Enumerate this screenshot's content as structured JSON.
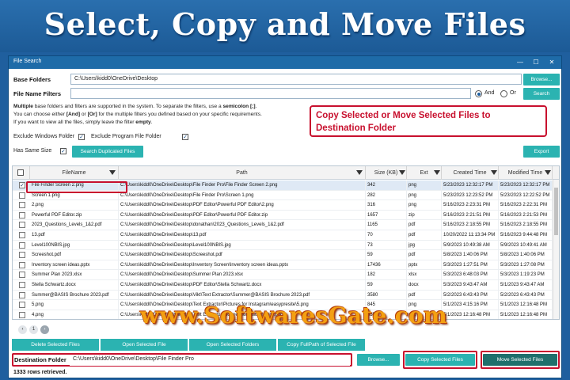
{
  "banner": {
    "title": "Select, Copy and Move Files"
  },
  "window": {
    "title": "File Search",
    "controls": {
      "minimize": "—",
      "maximize": "☐",
      "close": "✕"
    }
  },
  "base_folders": {
    "label": "Base Folders",
    "value": "C:\\Users\\kidd0\\OneDrive\\Desktop",
    "browse_label": "Browse..."
  },
  "file_name_filters": {
    "label": "File Name Filters",
    "value": "",
    "and_label": "And",
    "or_label": "Or",
    "selected_logic": "And",
    "search_label": "Search"
  },
  "info": {
    "line1_a": "Multiple",
    "line1_b": " base folders and filters are supported in the system. To separate the filters, use a ",
    "line1_c": "semicolon [;]",
    "line1_d": ".",
    "line2_a": "You can choose either ",
    "line2_b": "[And]",
    "line2_c": " or ",
    "line2_d": "[Or]",
    "line2_e": " for the multiple filters you defined based on your specific requirements.",
    "line3_a": "If you want to view all the files, simply leave the filter ",
    "line3_b": "empty",
    "line3_c": "."
  },
  "options": {
    "exclude_windows": {
      "label": "Exclude Windows Folder",
      "checked": true
    },
    "exclude_program": {
      "label": "Exclude Program File Folder",
      "checked": true
    },
    "has_same_size": {
      "label": "Has Same Size",
      "checked": true
    },
    "search_duplicated_label": "Search Duplicated Files",
    "export_label": "Export"
  },
  "callout": {
    "line1": "Copy Selected or Move Selected Files to",
    "line2": "Destination Folder"
  },
  "grid": {
    "columns": [
      "FileName",
      "Path",
      "Size (KB)",
      "Ext",
      "Created Time",
      "Modified Time"
    ],
    "rows": [
      {
        "checked": true,
        "name": "File Finder Screen 2.png",
        "path": "C:\\Users\\kidd0\\OneDrive\\Desktop\\File Finder Pro\\File Finder Screen 2.png",
        "size": "342",
        "ext": "png",
        "created": "5/23/2023 12:32:17 PM",
        "modified": "5/23/2023 12:32:17 PM"
      },
      {
        "checked": false,
        "name": "Screen 1.png",
        "path": "C:\\Users\\kidd0\\OneDrive\\Desktop\\File Finder Pro\\Screen 1.png",
        "size": "282",
        "ext": "png",
        "created": "5/23/2023 12:23:52 PM",
        "modified": "5/23/2023 12:22:52 PM"
      },
      {
        "checked": false,
        "name": "2.png",
        "path": "C:\\Users\\kidd0\\OneDrive\\Desktop\\PDF Editor\\Powerful PDF Editor\\2.png",
        "size": "316",
        "ext": "png",
        "created": "5/16/2023 2:23:31 PM",
        "modified": "5/16/2023 2:22:31 PM"
      },
      {
        "checked": false,
        "name": "Powerful PDF Editor.zip",
        "path": "C:\\Users\\kidd0\\OneDrive\\Desktop\\PDF Editor\\Powerful PDF Editor.zip",
        "size": "1657",
        "ext": "zip",
        "created": "5/16/2023 2:21:51 PM",
        "modified": "5/16/2023 2:21:53 PM"
      },
      {
        "checked": false,
        "name": "2023_Questions_Levels_1&2.pdf",
        "path": "C:\\Users\\kidd0\\OneDrive\\Desktop\\donathan\\2023_Questions_Levels_1&2.pdf",
        "size": "1165",
        "ext": "pdf",
        "created": "5/16/2023 2:18:55 PM",
        "modified": "5/16/2023 2:18:55 PM"
      },
      {
        "checked": false,
        "name": "13.pdf",
        "path": "C:\\Users\\kidd0\\OneDrive\\Desktop\\13.pdf",
        "size": "70",
        "ext": "pdf",
        "created": "10/20/2022 11:13:34 PM",
        "modified": "5/16/2023 9:44:48 PM"
      },
      {
        "checked": false,
        "name": "Level100NBIS.jpg",
        "path": "C:\\Users\\kidd0\\OneDrive\\Desktop\\Level100NBIS.jpg",
        "size": "73",
        "ext": "jpg",
        "created": "5/9/2023 10:49:38 AM",
        "modified": "5/9/2023 10:49:41 AM"
      },
      {
        "checked": false,
        "name": "Screeshot.pdf",
        "path": "C:\\Users\\kidd0\\OneDrive\\Desktop\\Screeshot.pdf",
        "size": "59",
        "ext": "pdf",
        "created": "5/8/2023 1:40:06 PM",
        "modified": "5/8/2023 1:40:06 PM"
      },
      {
        "checked": false,
        "name": "Inventory screen ideas.pptx",
        "path": "C:\\Users\\kidd0\\OneDrive\\Desktop\\Inventory Screen\\Inventory screen ideas.pptx",
        "size": "17436",
        "ext": "pptx",
        "created": "5/3/2023 1:27:51 PM",
        "modified": "5/3/2023 1:27:08 PM"
      },
      {
        "checked": false,
        "name": "Summer Plan 2023.xlsx",
        "path": "C:\\Users\\kidd0\\OneDrive\\Desktop\\Summer Plan 2023.xlsx",
        "size": "182",
        "ext": "xlsx",
        "created": "5/3/2023 6:48:03 PM",
        "modified": "5/3/2023 1:19:23 PM"
      },
      {
        "checked": false,
        "name": "Stella Schwartz.docx",
        "path": "C:\\Users\\kidd0\\OneDrive\\Desktop\\PDF Editor\\Stella Schwartz.docx",
        "size": "59",
        "ext": "docx",
        "created": "5/3/2023 9:43:47 AM",
        "modified": "5/1/2023 9:43:47 AM"
      },
      {
        "checked": false,
        "name": "Summer@BASIS Brochure 2023.pdf",
        "path": "C:\\Users\\kidd0\\OneDrive\\Desktop\\Vikt\\Text Extractor\\Summer@BASIS Brochure 2023.pdf",
        "size": "3580",
        "ext": "pdf",
        "created": "5/2/2023 6:43:43 PM",
        "modified": "5/2/2023 6:43:43 PM"
      },
      {
        "checked": false,
        "name": "5.png",
        "path": "C:\\Users\\kidd0\\OneDrive\\Desktop\\Text Extractor\\Pictures for Instagram\\easypresite\\5.png",
        "size": "845",
        "ext": "png",
        "created": "5/1/2023 4:15:16 PM",
        "modified": "5/1/2023 12:16:48 PM"
      },
      {
        "checked": false,
        "name": "4.png",
        "path": "C:\\Users\\kidd0\\OneDrive\\Desktop\\Text Extractor\\Pictures for Instagram\\4.png",
        "size": "555",
        "ext": "png",
        "created": "5/1/2023 12:16:48 PM",
        "modified": "5/1/2023 12:16:48 PM"
      }
    ]
  },
  "pager": {
    "pages": [
      "‹",
      "1",
      "›"
    ],
    "current": "1"
  },
  "watermark": "www.SoftwaresGate.com",
  "actions": {
    "delete_label": "Delete Selected Files",
    "open_label": "Open Selected File",
    "open_folders_label": "Open Selected Folders",
    "copy_path_label": "Copy FullPath of Selected File"
  },
  "destination": {
    "label": "Destination Folder",
    "value": "C:\\Users\\kidd0\\OneDrive\\Desktop\\File Finder Pro",
    "browse_label": "Browse...",
    "copy_label": "Copy Selected Files",
    "move_label": "Move Selected Files"
  },
  "status": "1333 rows retrieved.",
  "colors": {
    "accent": "#2bb3b1",
    "titlebar": "#1e6ba8",
    "highlight": "#c8102e",
    "banner": "#1f5f9e",
    "watermark": "#f3a012"
  }
}
